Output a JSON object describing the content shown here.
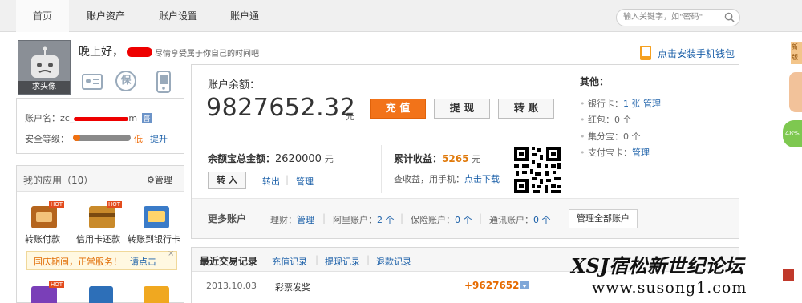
{
  "nav": {
    "items": [
      "首页",
      "账户资产",
      "账户设置",
      "账户通"
    ],
    "search_placeholder": "输入关键字，如\"密码\""
  },
  "profile": {
    "greeting": "晚上好，",
    "slogan": "尽情享受属于你自己的时间吧",
    "avatar_caption": "求头像",
    "account_label": "账户名：",
    "account_value_prefix": "zc_",
    "account_value_suffix": "m",
    "account_badge": "普",
    "security_label": "安全等级：",
    "security_level_text": "低",
    "security_level_fraction": 0.12,
    "upgrade_link": "提升",
    "ins_badge": "保"
  },
  "mobile_promo": "点击安装手机钱包",
  "balance": {
    "label": "账户余额：",
    "amount": "9827652.32",
    "unit": "元",
    "btn_recharge": "充 值",
    "btn_withdraw": "提 现",
    "btn_transfer": "转 账"
  },
  "yuebao": {
    "label": "余额宝总金额：",
    "amount": "2620000",
    "unit": "元",
    "transfer_in": "转 入",
    "transfer_out": "转出",
    "manage": "管理",
    "income_label": "累计收益：",
    "income_value": "5265",
    "income_unit": "元",
    "income_hint": "查收益，用手机：",
    "download": "点击下载"
  },
  "other": {
    "title": "其他：",
    "bank_card_label": "银行卡：",
    "bank_card_count": "1 张",
    "bank_card_manage": "管理",
    "red_packet_label": "红包：",
    "red_packet_value": "0 个",
    "jifenbao_label": "集分宝：",
    "jifenbao_value": "0 个",
    "alipay_card_label": "支付宝卡：",
    "alipay_card_manage": "管理"
  },
  "more_accounts": {
    "title": "更多账户",
    "licai_label": "理财：",
    "licai_manage": "管理",
    "aliyun_label": "阿里账户：",
    "aliyun_value": "2 个",
    "insurance_label": "保险账户：",
    "insurance_value": "0 个",
    "telecom_label": "通讯账户：",
    "telecom_value": "0 个",
    "manage_all": "管理全部账户"
  },
  "apps": {
    "title": "我的应用（10）",
    "manage": "管理",
    "items": [
      {
        "label": "转账付款",
        "badge": "HOT"
      },
      {
        "label": "信用卡还款",
        "badge": "HOT"
      },
      {
        "label": "转账到银行卡",
        "badge": ""
      }
    ],
    "notice": "国庆期间，正常服务！",
    "notice_link": "请点击",
    "bottom_badge": "HOT"
  },
  "transactions": {
    "title": "最近交易记录",
    "tab_recharge": "充值记录",
    "tab_withdraw": "提现记录",
    "tab_refund": "退款记录",
    "rows": [
      {
        "date": "2013.10.03",
        "name": "彩票发奖",
        "amount": "+9627652"
      }
    ]
  },
  "watermark": {
    "brand": "XSJ宿松新世纪论坛",
    "url": "www.susong1.com"
  },
  "side": {
    "badge_text": "新版",
    "percent": "48%"
  },
  "colors": {
    "accent_orange": "#f27319",
    "link_blue": "#1a5fa8",
    "income_orange": "#e07a0c",
    "amount_orange": "#e66a00"
  }
}
